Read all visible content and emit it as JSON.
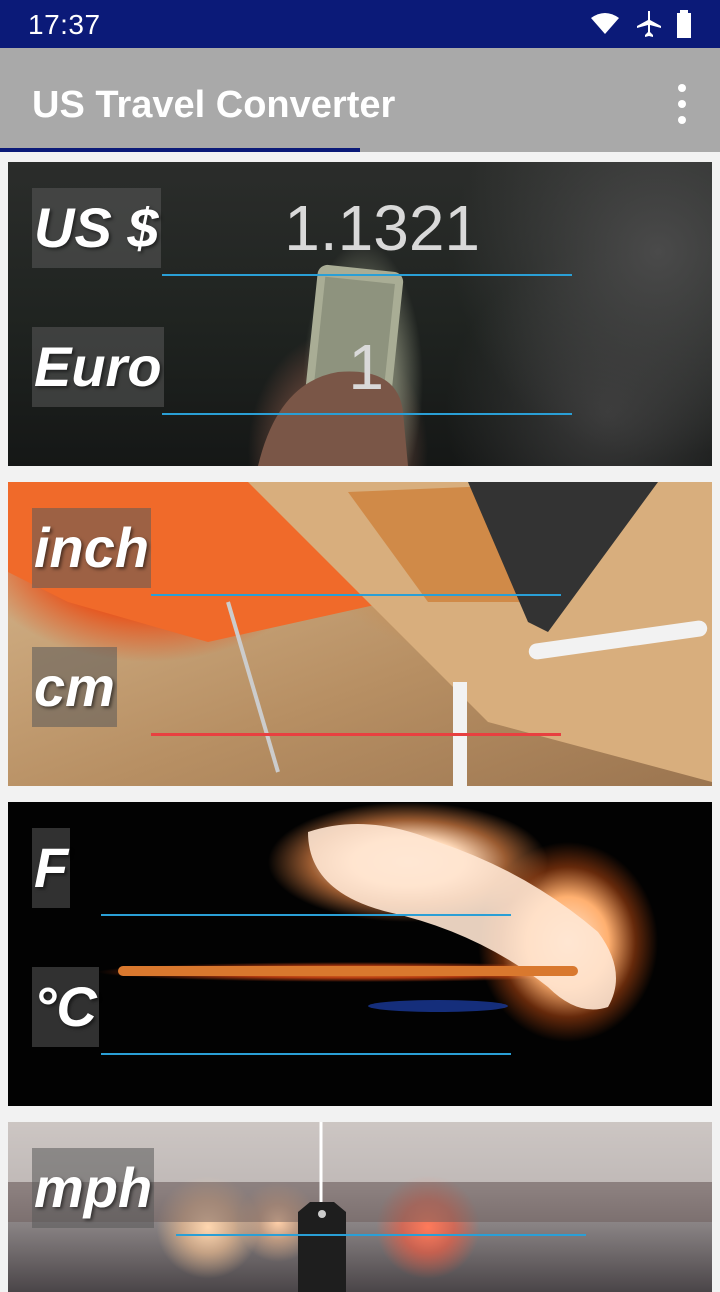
{
  "status_bar": {
    "time": "17:37"
  },
  "app_bar": {
    "title": "US Travel Converter"
  },
  "converters": {
    "currency": {
      "top_label": "US $",
      "top_value": "1.1321",
      "bottom_label": "Euro",
      "bottom_value": "1"
    },
    "length": {
      "top_label": "inch",
      "top_value": "",
      "bottom_label": "cm",
      "bottom_value": ""
    },
    "temperature": {
      "top_label": "F",
      "top_value": "",
      "bottom_label": "°C",
      "bottom_value": ""
    },
    "speed": {
      "top_label": "mph",
      "top_value": ""
    }
  },
  "colors": {
    "status_bar": "#0b1a78",
    "app_bar": "#a9a9a9",
    "field_underline": "#2a9fd6",
    "focused_underline": "#e84040"
  }
}
